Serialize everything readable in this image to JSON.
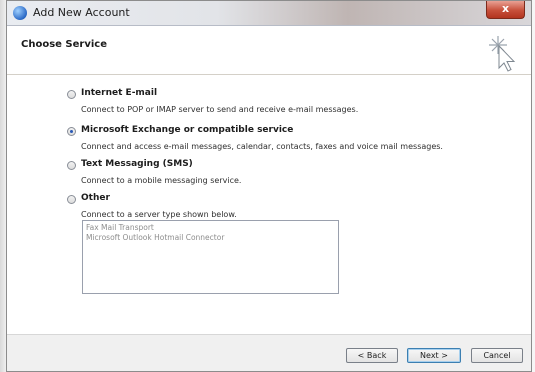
{
  "window": {
    "title": "Add New Account",
    "close_glyph": "x"
  },
  "header": {
    "title": "Choose Service",
    "icon_name": "wizard-sparkle-cursor-icon"
  },
  "options": [
    {
      "label": "Internet E-mail",
      "description": "Connect to POP or IMAP server to send and receive e-mail messages.",
      "checked": false
    },
    {
      "label": "Microsoft Exchange or compatible service",
      "description": "Connect and access e-mail messages, calendar, contacts, faxes and voice mail messages.",
      "checked": true
    },
    {
      "label": "Text Messaging (SMS)",
      "description": "Connect to a mobile messaging service.",
      "checked": false
    },
    {
      "label": "Other",
      "description": "Connect to a server type shown below.",
      "checked": false
    }
  ],
  "other_list": {
    "items": [
      "Fax Mail Transport",
      "Microsoft Outlook Hotmail Connector"
    ]
  },
  "footer": {
    "back_label": "< Back",
    "next_label": "Next >",
    "cancel_label": "Cancel"
  }
}
